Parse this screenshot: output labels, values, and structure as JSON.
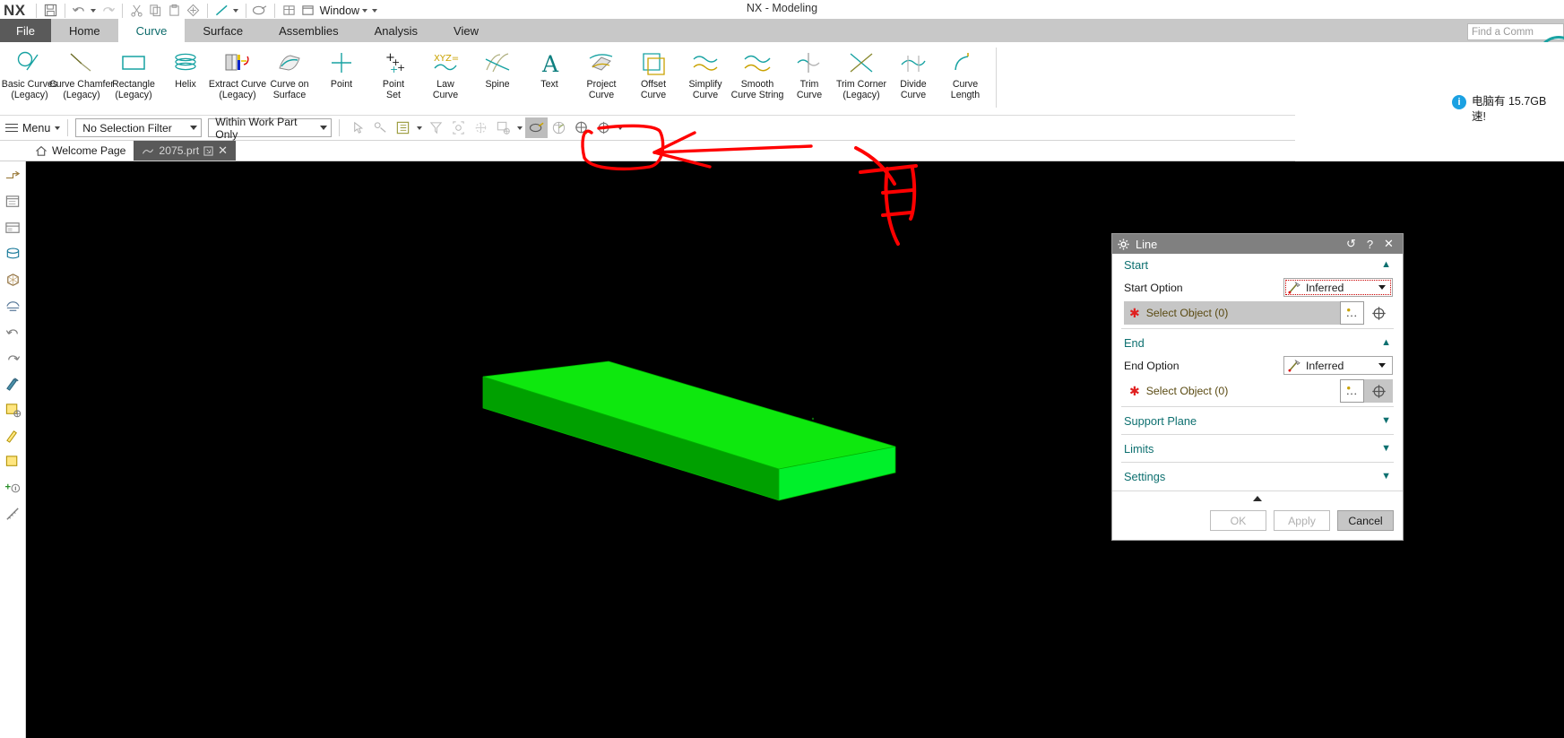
{
  "window": {
    "title": "NX - Modeling",
    "logo": "NX"
  },
  "quick_access": {
    "items": [
      {
        "name": "save-icon",
        "label": "Save"
      },
      {
        "name": "undo-icon",
        "label": "Undo"
      },
      {
        "name": "undo-dropdown-caret",
        "label": "Undo options"
      },
      {
        "name": "redo-icon",
        "label": "Redo"
      },
      {
        "name": "cut-icon",
        "label": "Cut"
      },
      {
        "name": "copy-icon",
        "label": "Copy"
      },
      {
        "name": "paste-icon",
        "label": "Paste"
      },
      {
        "name": "move-object-icon",
        "label": "Move Object"
      },
      {
        "name": "line-icon",
        "label": "Line"
      },
      {
        "name": "line-dropdown-caret",
        "label": "Line options"
      },
      {
        "name": "render-style-icon",
        "label": "Render Style"
      },
      {
        "name": "layout-icon",
        "label": "Layout"
      },
      {
        "name": "window-icon",
        "label": "Window"
      }
    ],
    "window_label": "Window"
  },
  "ribbon_tabs": [
    {
      "label": "File",
      "kind": "file"
    },
    {
      "label": "Home",
      "kind": "normal"
    },
    {
      "label": "Curve",
      "kind": "active"
    },
    {
      "label": "Surface",
      "kind": "normal"
    },
    {
      "label": "Assemblies",
      "kind": "normal"
    },
    {
      "label": "Analysis",
      "kind": "normal"
    },
    {
      "label": "View",
      "kind": "normal"
    }
  ],
  "find_command": {
    "placeholder": "Find a Comm"
  },
  "ribbon_commands": [
    {
      "name": "basic-curves-legacy",
      "line1": "Basic Curves",
      "line2": "(Legacy)",
      "icon": "circle-line-icon"
    },
    {
      "name": "curve-chamfer-legacy",
      "line1": "Curve Chamfer",
      "line2": "(Legacy)",
      "icon": "chamfer-icon"
    },
    {
      "name": "rectangle-legacy",
      "line1": "Rectangle",
      "line2": "(Legacy)",
      "icon": "rectangle-icon"
    },
    {
      "name": "helix",
      "line1": "Helix",
      "line2": "",
      "icon": "helix-icon"
    },
    {
      "name": "extract-curve-legacy",
      "line1": "Extract Curve",
      "line2": "(Legacy)",
      "icon": "extract-curve-icon"
    },
    {
      "name": "curve-on-surface",
      "line1": "Curve on",
      "line2": "Surface",
      "icon": "curve-on-surface-icon"
    },
    {
      "name": "point",
      "line1": "Point",
      "line2": "",
      "icon": "point-icon"
    },
    {
      "name": "point-set",
      "line1": "Point",
      "line2": "Set",
      "icon": "point-set-icon"
    },
    {
      "name": "law-curve",
      "line1": "Law",
      "line2": "Curve",
      "icon": "law-curve-icon"
    },
    {
      "name": "spine",
      "line1": "Spine",
      "line2": "",
      "icon": "spine-icon"
    },
    {
      "name": "text",
      "line1": "Text",
      "line2": "",
      "icon": "text-icon"
    },
    {
      "name": "project-curve",
      "line1": "Project",
      "line2": "Curve",
      "icon": "project-curve-icon"
    },
    {
      "name": "offset-curve",
      "line1": "Offset",
      "line2": "Curve",
      "icon": "offset-curve-icon"
    },
    {
      "name": "simplify-curve",
      "line1": "Simplify",
      "line2": "Curve",
      "icon": "simplify-curve-icon"
    },
    {
      "name": "smooth-curve-string",
      "line1": "Smooth",
      "line2": "Curve String",
      "icon": "smooth-curve-icon"
    },
    {
      "name": "trim-curve",
      "line1": "Trim",
      "line2": "Curve",
      "icon": "trim-curve-icon"
    },
    {
      "name": "trim-corner-legacy",
      "line1": "Trim Corner",
      "line2": "(Legacy)",
      "icon": "trim-corner-icon"
    },
    {
      "name": "divide-curve",
      "line1": "Divide",
      "line2": "Curve",
      "icon": "divide-curve-icon"
    },
    {
      "name": "curve-length",
      "line1": "Curve",
      "line2": "Length",
      "icon": "curve-length-icon"
    }
  ],
  "selection_bar": {
    "menu_label": "Menu",
    "selection_filter": {
      "value": "No Selection Filter",
      "options": [
        "No Selection Filter"
      ]
    },
    "scope": {
      "value": "Within Work Part Only",
      "options": [
        "Within Work Part Only"
      ]
    },
    "tool_icons": [
      {
        "name": "select-general-icon"
      },
      {
        "name": "select-feature-icon"
      },
      {
        "name": "class-selection-icon"
      },
      {
        "name": "class-selection-caret"
      },
      {
        "name": "filter-icon"
      },
      {
        "name": "face-select-icon"
      },
      {
        "name": "component-select-icon"
      },
      {
        "name": "box-select-icon"
      },
      {
        "name": "box-select-caret"
      },
      {
        "name": "highlight-toggle-icon"
      },
      {
        "name": "section-view-icon"
      },
      {
        "name": "snap-point-icon"
      },
      {
        "name": "snap-point-2-icon"
      },
      {
        "name": "snap-point-caret"
      }
    ]
  },
  "doc_tabs": [
    {
      "name": "welcome-page",
      "label": "Welcome Page",
      "active": false,
      "closeable": false
    },
    {
      "name": "part-2075",
      "label": "2075.prt",
      "active": true,
      "closeable": true
    }
  ],
  "resource_bar": [
    {
      "name": "assembly-navigator-icon"
    },
    {
      "name": "constraint-navigator-icon"
    },
    {
      "name": "part-navigator-icon"
    },
    {
      "name": "reuse-library-icon"
    },
    {
      "name": "hd3d-tools-icon"
    },
    {
      "name": "web-browser-icon"
    },
    {
      "name": "history-icon"
    },
    {
      "name": "process-studio-icon"
    },
    {
      "name": "role-advanced-icon"
    },
    {
      "name": "role-essentials-icon"
    },
    {
      "name": "system-scene-icon"
    },
    {
      "name": "customize-icon"
    }
  ],
  "dialog": {
    "title": "Line",
    "title_buttons": [
      {
        "name": "reset-button",
        "glyph": "↺"
      },
      {
        "name": "help-button",
        "glyph": "?"
      },
      {
        "name": "close-button",
        "glyph": "✕"
      }
    ],
    "groups": [
      {
        "name": "start",
        "label": "Start",
        "expanded": true,
        "option_label": "Start Option",
        "option_value": "Inferred",
        "select_label": "Select Object (0)",
        "select_active": true
      },
      {
        "name": "end",
        "label": "End",
        "expanded": true,
        "option_label": "End Option",
        "option_value": "Inferred",
        "select_label": "Select Object (0)",
        "select_active": false
      }
    ],
    "collapsed_groups": [
      {
        "name": "support-plane",
        "label": "Support Plane"
      },
      {
        "name": "limits",
        "label": "Limits"
      },
      {
        "name": "settings",
        "label": "Settings"
      }
    ],
    "buttons": [
      {
        "name": "ok-button",
        "label": "OK",
        "enabled": false
      },
      {
        "name": "apply-button",
        "label": "Apply",
        "enabled": false
      },
      {
        "name": "cancel-button",
        "label": "Cancel",
        "enabled": true
      }
    ]
  },
  "notification": {
    "icon": "info-icon",
    "line1": "电脑有 15.7GB",
    "line2": "速!",
    "accent_color": "#0a8ac4"
  },
  "annotations": {
    "color": "#ff0000",
    "shapes": [
      {
        "name": "ellipse-highlight-snap-tools"
      },
      {
        "name": "arrow-pointing-left"
      },
      {
        "name": "handwritten-character-you"
      }
    ]
  },
  "model": {
    "name": "green-rectangular-block",
    "face_colors": {
      "top": "#00e600",
      "front": "#00a800",
      "right": "#00ff2a"
    }
  }
}
